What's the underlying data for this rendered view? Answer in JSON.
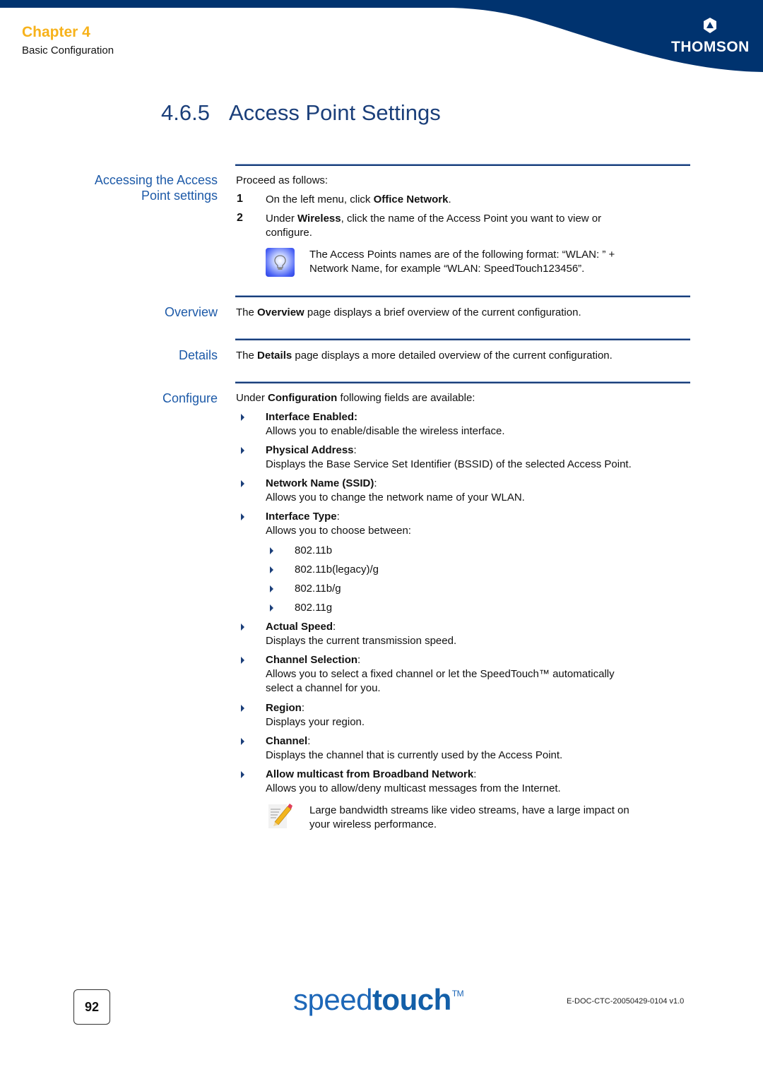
{
  "header": {
    "chapter": "Chapter 4",
    "chapter_subtitle": "Basic Configuration",
    "brand_logo_text": "THOMSON",
    "colors": {
      "banner": "#00336f",
      "chapter": "#f7b21b",
      "heading": "#1b3f7a",
      "side_heading": "#1d5aa8"
    }
  },
  "title": {
    "number": "4.6.5",
    "text": "Access Point Settings"
  },
  "sections": {
    "accessing": {
      "heading_line1": "Accessing the Access",
      "heading_line2": "Point settings",
      "intro": "Proceed as follows:",
      "steps": [
        {
          "num": "1",
          "pre": "On the left menu, click ",
          "bold": "Office Network",
          "post": "."
        },
        {
          "num": "2",
          "pre": "Under ",
          "bold": "Wireless",
          "post": ", click the name of the Access Point you want to view or",
          "cont": "configure."
        }
      ],
      "note_line1": "The Access Points names are of the following format: “WLAN: ” +",
      "note_line2": "Network Name, for example “WLAN: SpeedTouch123456”.",
      "note_icon": "lightbulb-icon"
    },
    "overview": {
      "heading": "Overview",
      "pre": "The ",
      "bold": "Overview",
      "post": " page displays a brief overview of the current configuration."
    },
    "details": {
      "heading": "Details",
      "pre": "The ",
      "bold": "Details",
      "post": " page displays a more detailed overview of the current configuration."
    },
    "configure": {
      "heading": "Configure",
      "intro_pre": "Under ",
      "intro_bold": "Configuration",
      "intro_post": " following fields are available:",
      "fields": [
        {
          "name": "Interface Enabled",
          "suffix": ":",
          "desc": "Allows you to enable/disable the wireless interface."
        },
        {
          "name": "Physical Address",
          "suffix": ":",
          "desc": "Displays the Base Service Set Identifier (BSSID) of the selected Access Point."
        },
        {
          "name": "Network Name (SSID)",
          "suffix": ":",
          "desc": "Allows you to change the network name of your WLAN."
        },
        {
          "name": "Interface Type",
          "suffix": ":",
          "desc": "Allows you to choose between:"
        },
        {
          "name": "Actual Speed",
          "suffix": ":",
          "desc": "Displays the current transmission speed."
        },
        {
          "name": "Channel Selection",
          "suffix": ":",
          "desc": "Allows you to select a fixed channel or let the SpeedTouch™ automatically",
          "desc2": "select a channel for you."
        },
        {
          "name": "Region",
          "suffix": ":",
          "desc": "Displays your region."
        },
        {
          "name": "Channel",
          "suffix": ":",
          "desc": "Displays the channel that is currently used by the Access Point."
        },
        {
          "name": "Allow multicast from Broadband Network",
          "suffix": ":",
          "desc": "Allows you to allow/deny multicast messages from the Internet."
        }
      ],
      "interface_types": [
        "802.11b",
        "802.11b(legacy)/g",
        "802.11b/g",
        "802.11g"
      ],
      "note_line1": "Large bandwidth streams like video streams, have a large impact on",
      "note_line2": "your wireless performance.",
      "note_icon": "pencil-note-icon"
    }
  },
  "footer": {
    "page_number": "92",
    "brand_light": "speed",
    "brand_bold": "touch",
    "brand_tm": "TM",
    "doc_id": "E-DOC-CTC-20050429-0104 v1.0"
  }
}
